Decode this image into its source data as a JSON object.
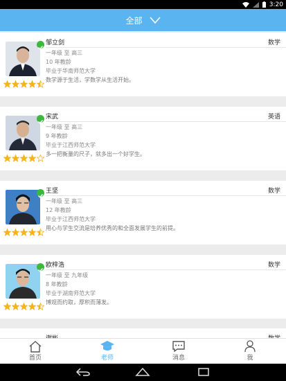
{
  "status_bar": {
    "time": "3:20"
  },
  "header": {
    "title": "全部"
  },
  "teachers": [
    {
      "name": "邹立剑",
      "subject": "数学",
      "grades": "一年级 至 高三",
      "years": "10 年教龄",
      "school": "毕业于华南师范大学",
      "motto": "数学源于生活，学数学从生活开始。",
      "rating": 4.5
    },
    {
      "name": "宋武",
      "subject": "英语",
      "grades": "一年级 至 高三",
      "years": "9 年教龄",
      "school": "毕业于江西师范大学",
      "motto": "多一把衡量的尺子，就多出一个好学生。",
      "rating": 4
    },
    {
      "name": "王坚",
      "subject": "数学",
      "grades": "一年级 至 高三",
      "years": "12 年教龄",
      "school": "毕业于江西师范大学",
      "motto": "用心与学生交流是培养优秀的和全面发展学生的前提。",
      "rating": 4.5
    },
    {
      "name": "欧梓浩",
      "subject": "数学",
      "grades": "一年级 至 九年级",
      "years": "8 年教龄",
      "school": "毕业于湖南师范大学",
      "motto": "博观而约取，厚积而薄发。",
      "rating": 4.5
    },
    {
      "name": "谢彬",
      "subject": "数学"
    }
  ],
  "tabs": [
    {
      "label": "首页",
      "icon": "home-icon"
    },
    {
      "label": "老师",
      "icon": "graduation-cap-icon"
    },
    {
      "label": "消息",
      "icon": "message-icon"
    },
    {
      "label": "我",
      "icon": "person-icon"
    }
  ],
  "colors": {
    "accent": "#5ab4f0",
    "star": "#f5b41e",
    "verified": "#3cb93c"
  }
}
